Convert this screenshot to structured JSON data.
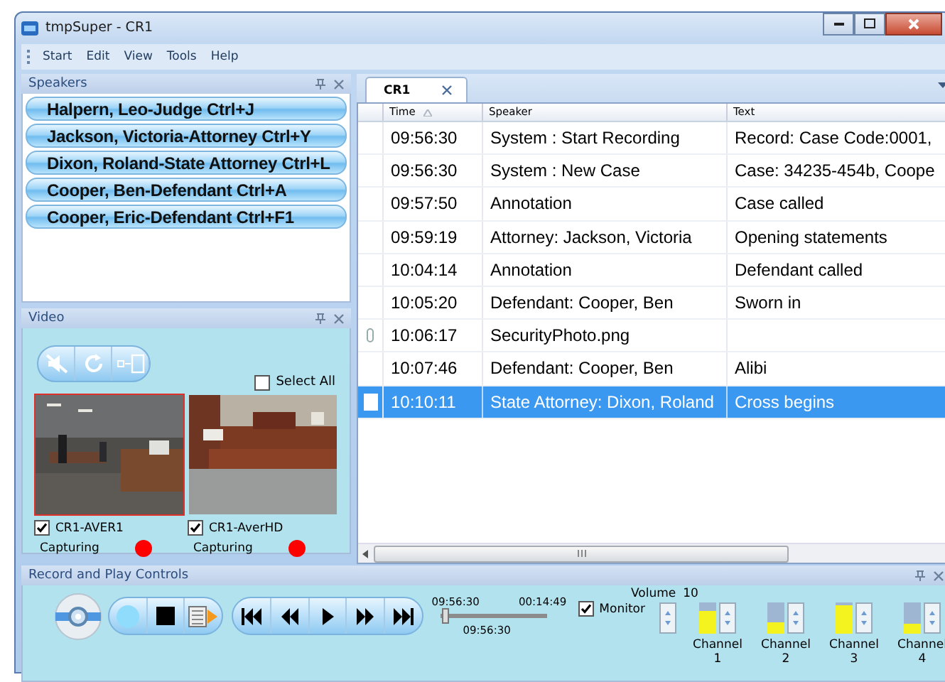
{
  "window": {
    "title": "tmpSuper - CR1"
  },
  "menu": [
    "Start",
    "Edit",
    "View",
    "Tools",
    "Help"
  ],
  "speakers_panel": {
    "title": "Speakers",
    "items": [
      {
        "label": "Halpern, Leo-Judge Ctrl+J"
      },
      {
        "label": "Jackson, Victoria-Attorney Ctrl+Y"
      },
      {
        "label": "Dixon, Roland-State Attorney Ctrl+L"
      },
      {
        "label": "Cooper, Ben-Defendant Ctrl+A"
      },
      {
        "label": "Cooper, Eric-Defendant Ctrl+F1"
      }
    ]
  },
  "video_panel": {
    "title": "Video",
    "select_all": {
      "label": "Select All",
      "checked": false
    },
    "cameras": [
      {
        "name": "CR1-AVER1",
        "checked": true,
        "selected": true,
        "status": "Capturing"
      },
      {
        "name": "CR1-AverHD",
        "checked": true,
        "selected": false,
        "status": "Capturing"
      }
    ]
  },
  "tabs": [
    {
      "label": "CR1",
      "selected": true
    }
  ],
  "table": {
    "columns": [
      "Time",
      "Speaker",
      "Text"
    ],
    "rows": [
      {
        "kind": "entry",
        "time": "09:56:30",
        "speaker": "System : Start Recording",
        "text": "Record: Case Code:0001,",
        "selected": false
      },
      {
        "kind": "entry",
        "time": "09:56:30",
        "speaker": "System : New Case",
        "text": "Case: 34235-454b, Coope",
        "selected": false
      },
      {
        "kind": "entry",
        "time": "09:57:50",
        "speaker": "Annotation",
        "text": "Case called",
        "selected": false
      },
      {
        "kind": "entry",
        "time": "09:59:19",
        "speaker": "Attorney: Jackson, Victoria",
        "text": "Opening statements",
        "selected": false
      },
      {
        "kind": "entry",
        "time": "10:04:14",
        "speaker": "Annotation",
        "text": "Defendant called",
        "selected": false
      },
      {
        "kind": "entry",
        "time": "10:05:20",
        "speaker": "Defendant: Cooper, Ben",
        "text": "Sworn in",
        "selected": false
      },
      {
        "kind": "attachment",
        "time": "10:06:17",
        "speaker": "SecurityPhoto.png",
        "selected": false
      },
      {
        "kind": "entry",
        "time": "10:07:46",
        "speaker": "Defendant: Cooper, Ben",
        "text": "Alibi",
        "selected": false
      },
      {
        "kind": "entry",
        "time": "10:10:11",
        "speaker": "State Attorney: Dixon, Roland",
        "text": "Cross begins",
        "selected": true
      }
    ]
  },
  "controls_panel": {
    "title": "Record and Play Controls",
    "start_time": "09:56:30",
    "end_time": "00:14:49",
    "current_time": "09:56:30",
    "position": {
      "level": 0.02
    },
    "monitor": {
      "label": "Monitor",
      "checked": true
    },
    "volume": {
      "label": "Volume",
      "value": "10"
    },
    "channels": [
      {
        "label": "Channel",
        "number": "1",
        "level": 0.75
      },
      {
        "label": "Channel",
        "number": "2",
        "level": 0.35
      },
      {
        "label": "Channel",
        "number": "3",
        "level": 0.9
      },
      {
        "label": "Channel",
        "number": "4",
        "level": 0.3
      }
    ]
  }
}
